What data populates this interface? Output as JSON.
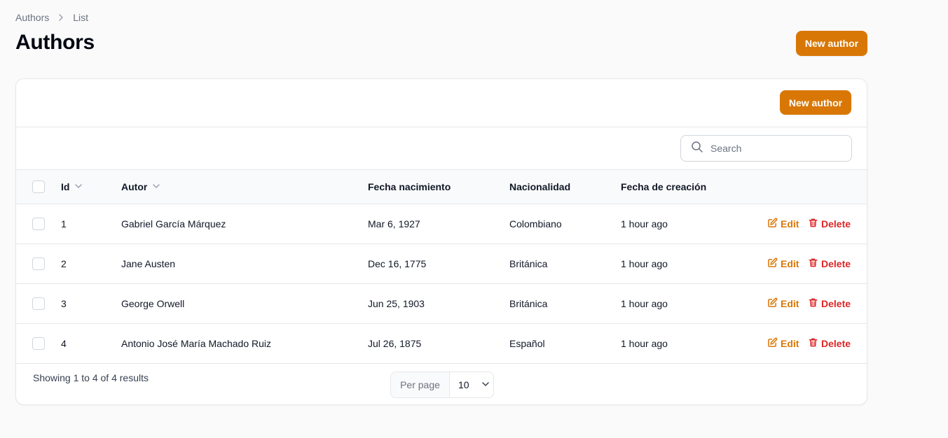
{
  "breadcrumb": {
    "items": [
      "Authors",
      "List"
    ]
  },
  "page": {
    "title": "Authors",
    "new_button": "New author"
  },
  "table": {
    "new_button": "New author",
    "search_placeholder": "Search",
    "columns": [
      "Id",
      "Autor",
      "Fecha nacimiento",
      "Nacionalidad",
      "Fecha de creación"
    ],
    "rows": [
      {
        "id": "1",
        "autor": "Gabriel García Márquez",
        "fecha_nacimiento": "Mar 6, 1927",
        "nacionalidad": "Colombiano",
        "creacion": "1 hour ago"
      },
      {
        "id": "2",
        "autor": "Jane Austen",
        "fecha_nacimiento": "Dec 16, 1775",
        "nacionalidad": "Británica",
        "creacion": "1 hour ago"
      },
      {
        "id": "3",
        "autor": "George Orwell",
        "fecha_nacimiento": "Jun 25, 1903",
        "nacionalidad": "Británica",
        "creacion": "1 hour ago"
      },
      {
        "id": "4",
        "autor": "Antonio José María Machado Ruiz",
        "fecha_nacimiento": "Jul 26, 1875",
        "nacionalidad": "Español",
        "creacion": "1 hour ago"
      }
    ],
    "actions": {
      "edit": "Edit",
      "delete": "Delete"
    },
    "footer": {
      "summary": "Showing 1 to 4 of 4 results",
      "per_page_label": "Per page",
      "per_page_value": "10"
    }
  },
  "colors": {
    "primary": "#d97706",
    "danger": "#dc2626",
    "muted": "#6b7280"
  },
  "icons": [
    "chevron-right-icon",
    "search-icon",
    "chevron-down-icon",
    "edit-icon",
    "trash-icon"
  ]
}
